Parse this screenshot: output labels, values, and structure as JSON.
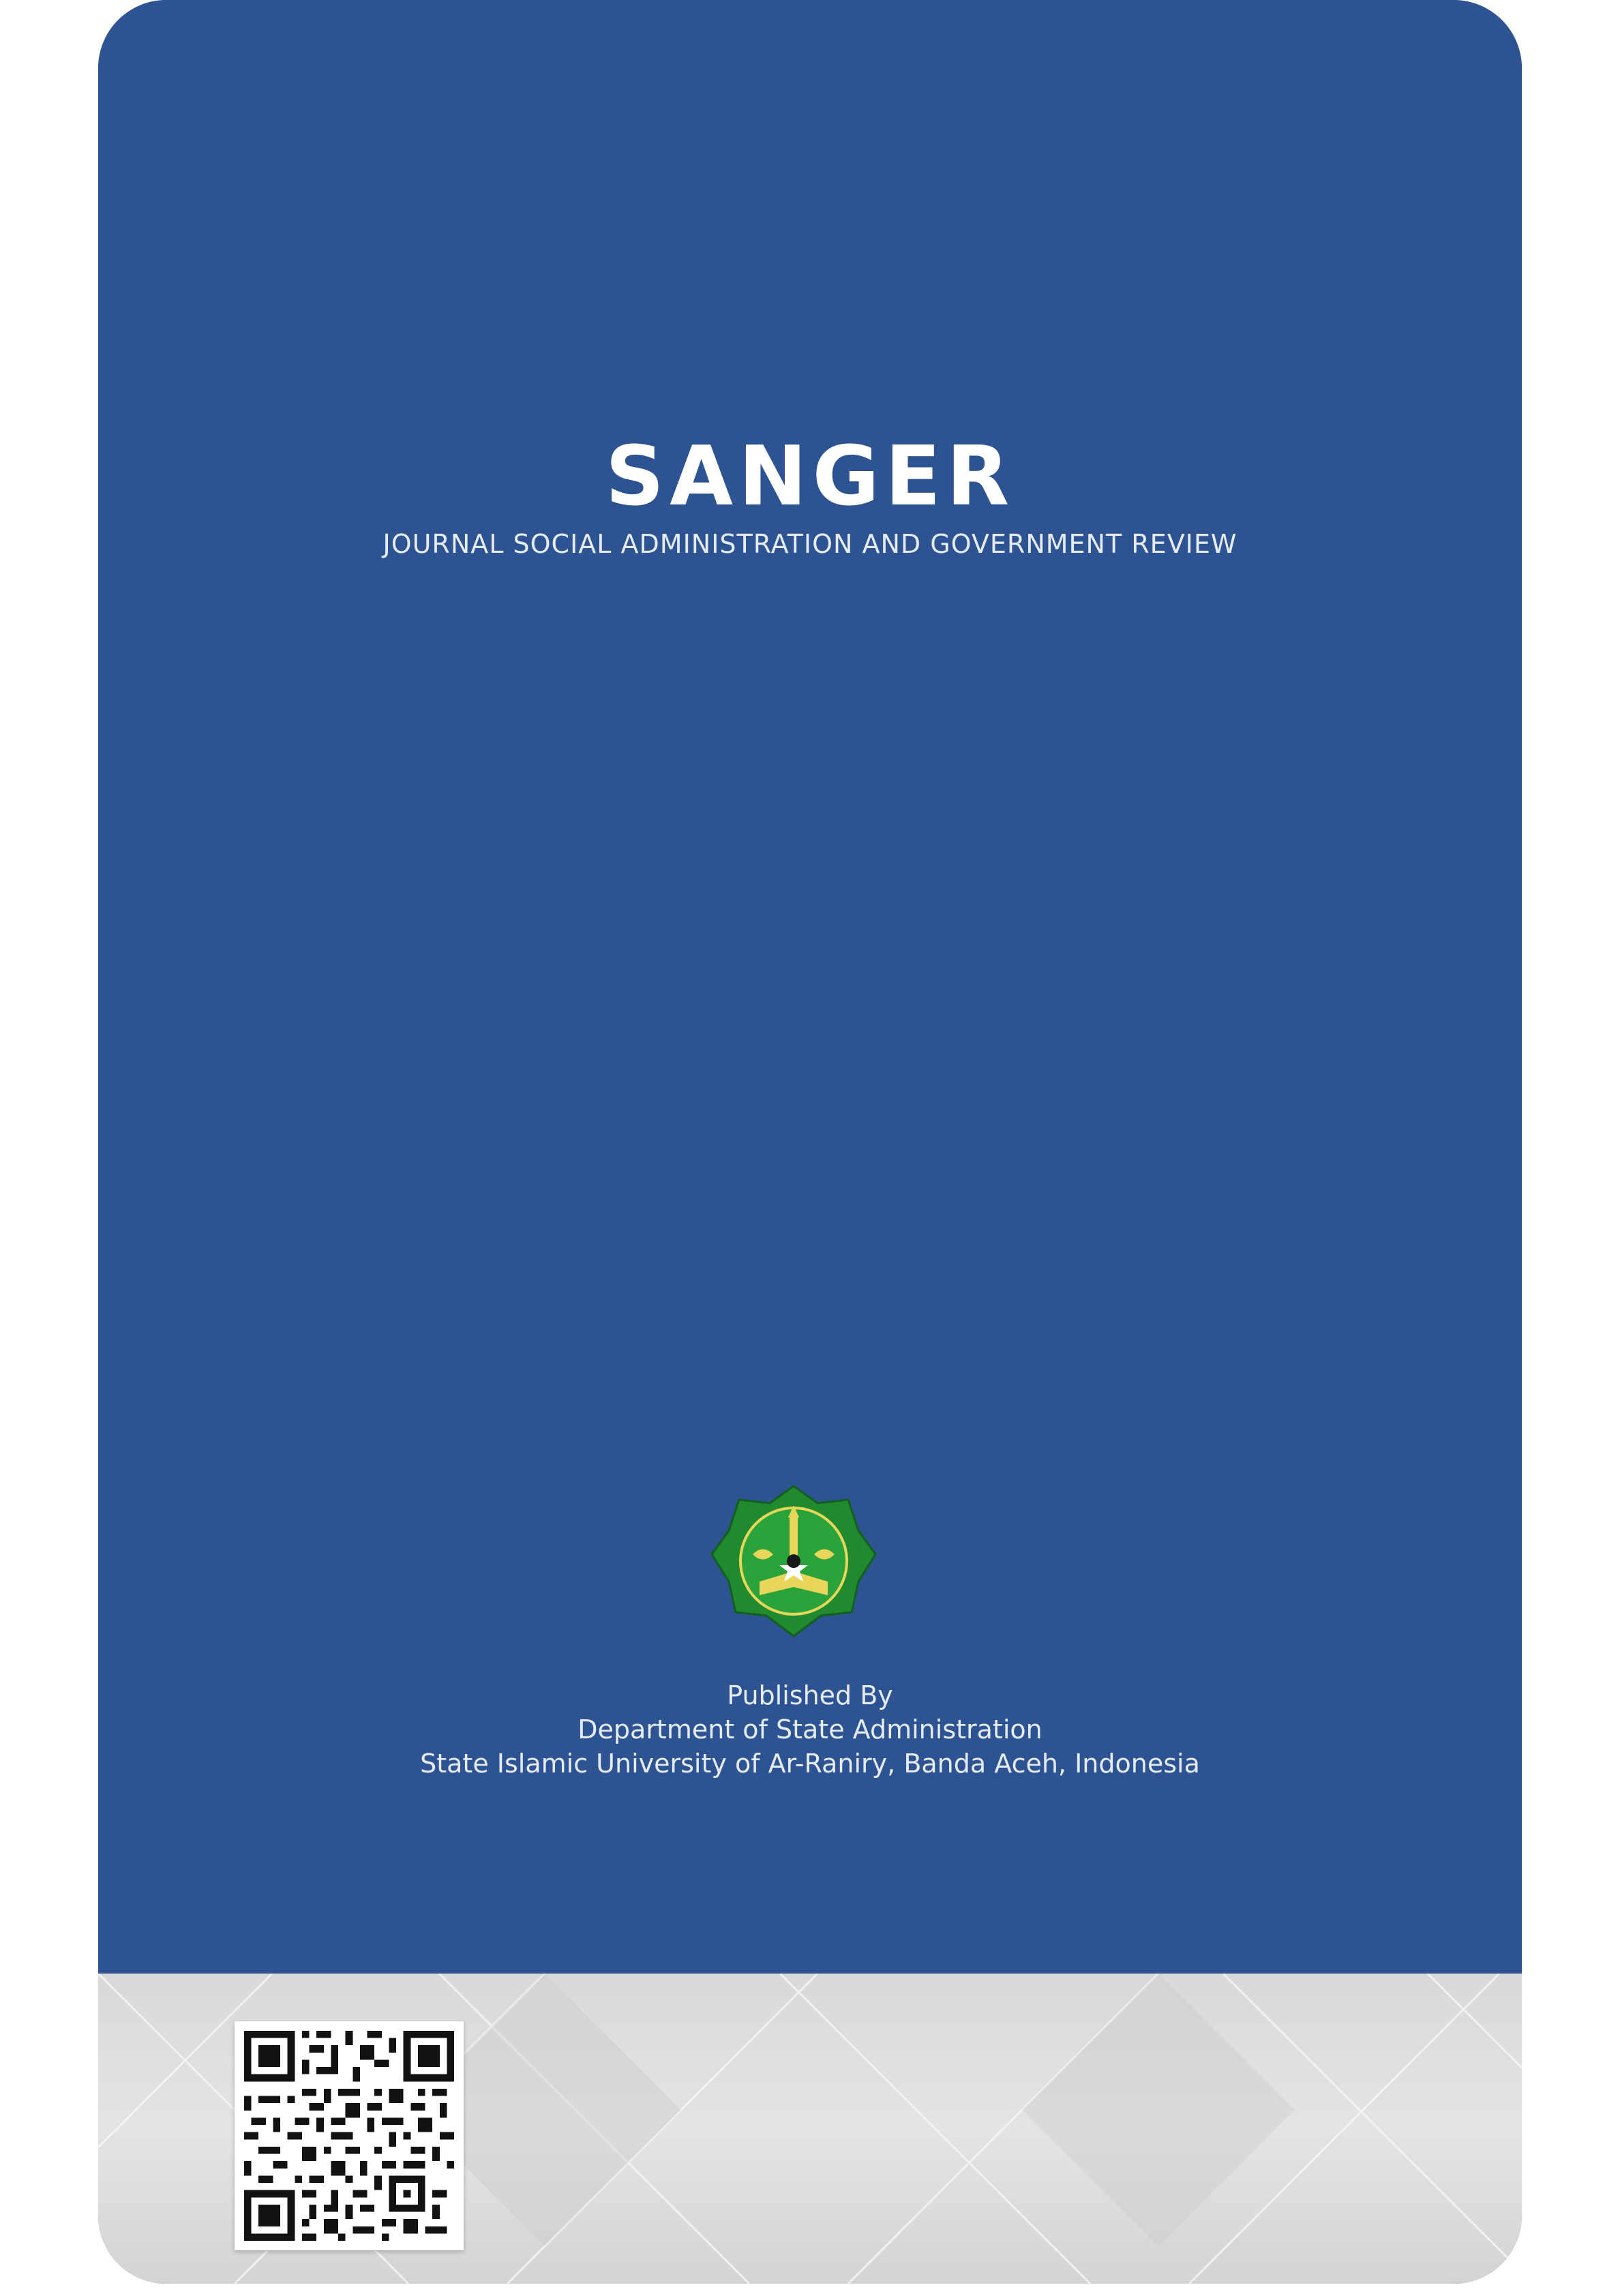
{
  "journal": {
    "title": "SANGER",
    "subtitle": "JOURNAL SOCIAL ADMINISTRATION AND GOVERNMENT REVIEW"
  },
  "publisher": {
    "line1": "Published By",
    "line2": "Department of State Administration",
    "line3": "State Islamic University of Ar-Raniry, Banda Aceh, Indonesia"
  },
  "colors": {
    "cover_blue": "#2e5393",
    "footer_gray": "#dcdcdc",
    "logo_green": "#1f8a2e",
    "logo_gold": "#d9c23a"
  },
  "icons": {
    "logo": "university-emblem-icon",
    "qr": "qr-code-icon"
  }
}
